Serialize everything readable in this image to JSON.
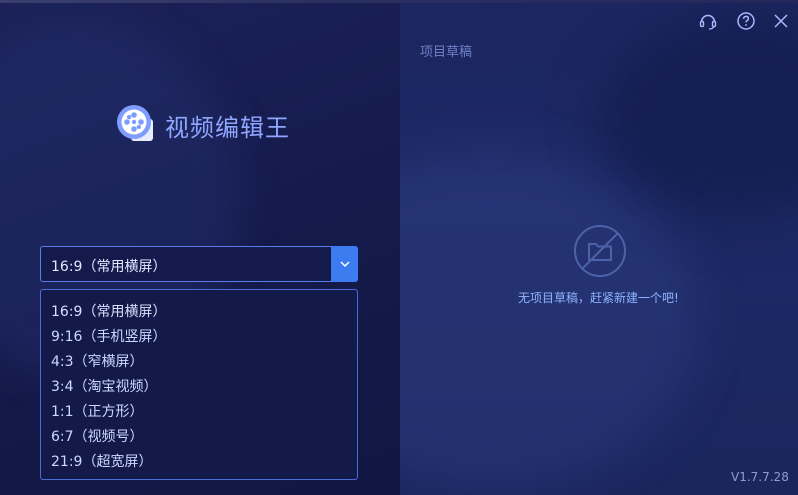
{
  "app": {
    "title": "视频编辑王",
    "version": "V1.7.7.28"
  },
  "aspect_select": {
    "selected": "16:9（常用横屏）",
    "options": [
      "16:9（常用横屏）",
      "9:16（手机竖屏）",
      "4:3（窄横屏）",
      "3:4（淘宝视频）",
      "1:1（正方形）",
      "6:7（视频号）",
      "21:9（超宽屏）"
    ]
  },
  "drafts": {
    "label": "项目草稿",
    "empty_text": "无项目草稿，赶紧新建一个吧!"
  },
  "window_controls": {
    "icons": [
      "headset-icon",
      "help-icon",
      "close-icon"
    ]
  },
  "colors": {
    "accent": "#3d7cf0",
    "brand_title": "#8fa6ff",
    "empty_text": "#8fb4ff"
  }
}
